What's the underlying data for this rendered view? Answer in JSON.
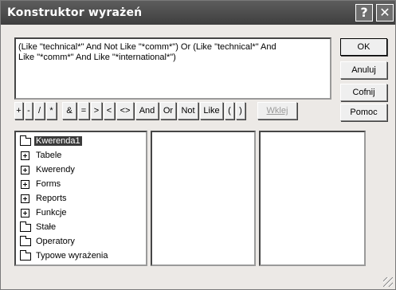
{
  "window": {
    "title": "Konstruktor wyrażeń",
    "help_glyph": "?",
    "close_glyph": "✕"
  },
  "expression": {
    "line1": "(Like \"technical*\" And Not Like \"*comm*\") Or (Like \"technical*\" And",
    "line2": "Like \"*comm*\" And Like \"*international*\")"
  },
  "buttons": {
    "ok": "OK",
    "cancel": "Anuluj",
    "undo": "Cofnij",
    "help": "Pomoc"
  },
  "operators": [
    "+",
    "-",
    "/",
    "*",
    "&",
    "=",
    ">",
    "<",
    "<>",
    "And",
    "Or",
    "Not",
    "Like",
    "(",
    ")"
  ],
  "paste_label": "Wklej",
  "tree": [
    {
      "label": "Kwerenda1",
      "icon": "open-folder-icon",
      "selected": true
    },
    {
      "label": "Tabele",
      "icon": "expand-plus-icon"
    },
    {
      "label": "Kwerendy",
      "icon": "expand-plus-icon"
    },
    {
      "label": "Forms",
      "icon": "expand-plus-icon"
    },
    {
      "label": "Reports",
      "icon": "expand-plus-icon"
    },
    {
      "label": "Funkcje",
      "icon": "expand-plus-icon"
    },
    {
      "label": "Stałe",
      "icon": "folder-icon"
    },
    {
      "label": "Operatory",
      "icon": "folder-icon"
    },
    {
      "label": "Typowe wyrażenia",
      "icon": "folder-icon"
    }
  ]
}
